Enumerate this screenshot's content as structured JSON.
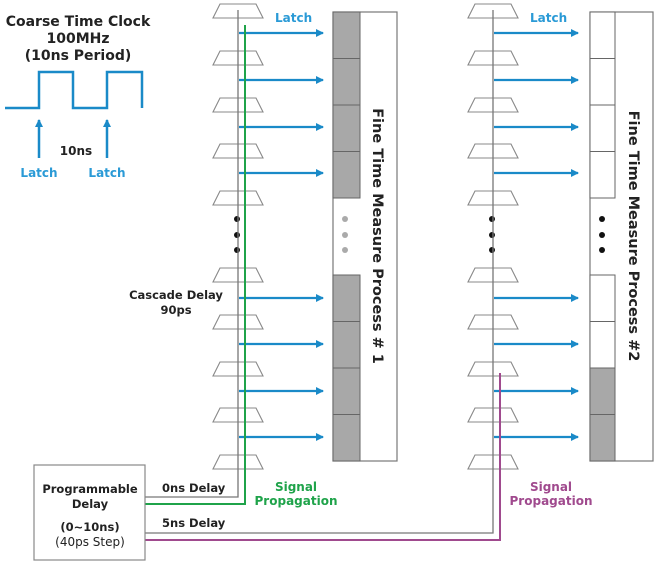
{
  "clock": {
    "title_line1": "Coarse Time Clock",
    "title_line2": "100MHz",
    "title_line3": "(10ns Period)",
    "period_label": "10ns",
    "latch_label_1": "Latch",
    "latch_label_2": "Latch"
  },
  "chain1": {
    "latch_label": "Latch",
    "cascade_line1": "Cascade Delay",
    "cascade_line2": "90ps",
    "delay_label": "0ns Delay",
    "signal_line1": "Signal",
    "signal_line2": "Propagation",
    "process_label": "Fine Time Measure Process # 1",
    "cells_top_filled": [
      true,
      true,
      true,
      true
    ],
    "cells_bottom_filled": [
      true,
      true,
      true,
      true
    ]
  },
  "chain2": {
    "latch_label": "Latch",
    "delay_label": "5ns Delay",
    "signal_line1": "Signal",
    "signal_line2": "Propagation",
    "process_label": "Fine Time Measure Process #2",
    "cells_top_filled": [
      false,
      false,
      false,
      false
    ],
    "cells_bottom_filled": [
      false,
      false,
      true,
      true
    ]
  },
  "delay_box": {
    "line1": "Programmable",
    "line2": "Delay",
    "line3": "(0~10ns)",
    "line4": "(40ps Step)"
  },
  "colors": {
    "clock_blue": "#1a8ac8",
    "latch_blue": "#2a9ad6",
    "green": "#1fa34a",
    "magenta": "#a04a8e",
    "cell_fill": "#a8a8a8",
    "line_gray": "#777777"
  }
}
